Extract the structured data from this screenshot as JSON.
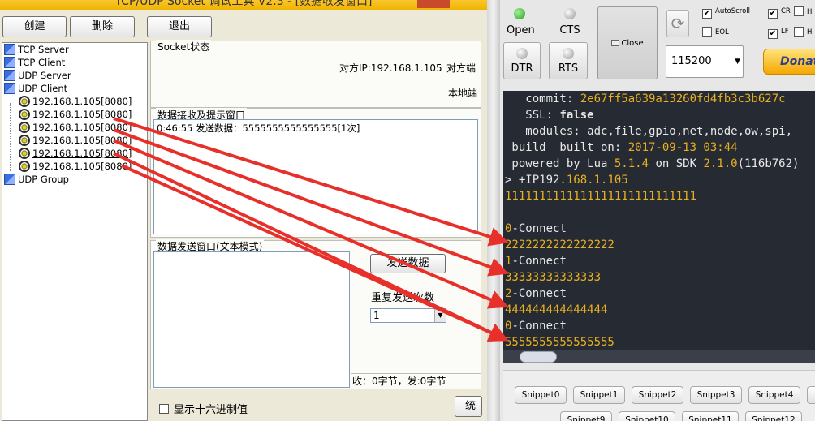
{
  "left": {
    "title": "TCP/UDP Socket 调试工具 V2.3 - [数据收发窗口]",
    "toolbar": {
      "create": "创建",
      "delete": "删除",
      "exit": "退出"
    },
    "tree": {
      "tcp_server": "TCP Server",
      "tcp_client": "TCP Client",
      "udp_server": "UDP Server",
      "udp_client": "UDP Client",
      "connections": [
        "192.168.1.105[8080]",
        "192.168.1.105[8080]",
        "192.168.1.105[8080]",
        "192.168.1.105[8080]",
        "192.168.1.105[8080]",
        "192.168.1.105[8080]"
      ],
      "udp_group": "UDP Group"
    },
    "socket_status": {
      "title": "Socket状态",
      "peer_ip": "对方IP:192.168.1.105",
      "peer_port": "对方端",
      "local_port": "本地端"
    },
    "recv": {
      "title": "数据接收及提示窗口",
      "log": "0:46:55 发送数据：5555555555555555[1次]"
    },
    "send": {
      "title": "数据发送窗口(文本模式)",
      "send_button": "发送数据",
      "repeat_label": "重复发送次数",
      "repeat_value": "1",
      "stats": "收：0字节，发:0字节"
    },
    "hex_checkbox": "显示十六进制值",
    "continue_button": "统"
  },
  "right": {
    "open": "Open",
    "cts": "CTS",
    "dtr": "DTR",
    "rts": "RTS",
    "close": "Close",
    "options": {
      "autoscroll": "AutoScroll",
      "eol": "EOL",
      "cr": "CR",
      "lf": "LF",
      "h": "H"
    },
    "baud": "115200",
    "donate": "Donat",
    "terminal": {
      "commit_label": "   commit: ",
      "commit_value": "2e67ff5a639a13260fd4fb3c3b627c",
      "ssl_label": "   SSL: ",
      "ssl_value": "false",
      "modules_line": "   modules: adc,file,gpio,net,node,ow,spi,",
      "build_label": " build  built on: ",
      "build_value": "2017-09-13 03:44",
      "powered_a": " powered by Lua ",
      "powered_b": "5.1.4",
      "powered_c": " on SDK ",
      "powered_d": "2.1.0",
      "powered_e": "(116b762)",
      "prompt_a": "> +IP192.",
      "prompt_b": "168.1.105",
      "ones": "1111111111111111111111111111",
      "c0a": "0",
      "c0b": "-Connect",
      "twos": "2222222222222222",
      "c1a": "1",
      "c1b": "-Connect",
      "threes": "33333333333333",
      "c2a": "2",
      "c2b": "-Connect",
      "fours": "444444444444444",
      "c3a": "0",
      "c3b": "-Connect",
      "fives": "5555555555555555"
    },
    "snippets_row1": [
      "Snippet0",
      "Snippet1",
      "Snippet2",
      "Snippet3",
      "Snippet4"
    ],
    "snippets_row2": [
      "Snippet9",
      "Snippet10",
      "Snippet11",
      "Snippet12"
    ]
  },
  "colors": {
    "arrow": "#e8302a",
    "terminal_bg": "#262a33",
    "terminal_accent": "#e8b020"
  }
}
